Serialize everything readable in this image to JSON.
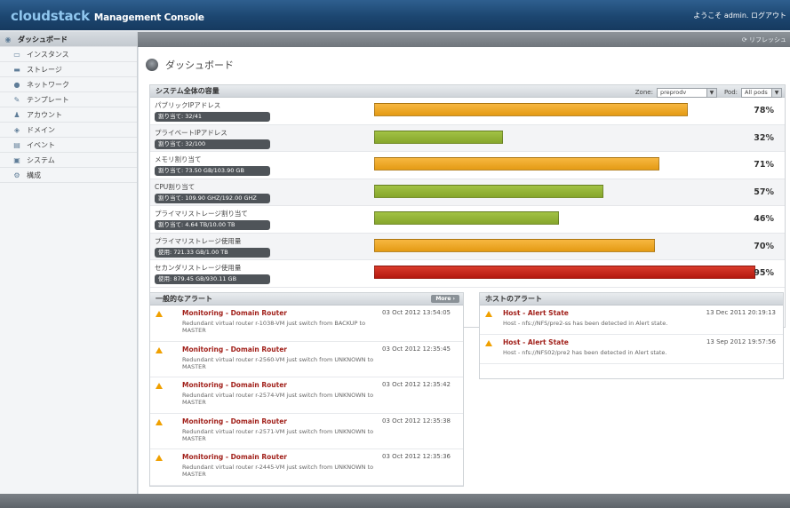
{
  "header": {
    "brand": "cloudstack",
    "console": "Management Console",
    "welcome": "ようこそ admin. ログアウト"
  },
  "subbar": {
    "refresh": "リフレッシュ"
  },
  "sidebar": {
    "items": [
      {
        "label": "ダッシュボード",
        "icon": "dashboard-icon",
        "active": true
      },
      {
        "label": "インスタンス",
        "icon": "instance-icon"
      },
      {
        "label": "ストレージ",
        "icon": "storage-icon"
      },
      {
        "label": "ネットワーク",
        "icon": "network-icon"
      },
      {
        "label": "テンプレート",
        "icon": "template-icon"
      },
      {
        "label": "アカウント",
        "icon": "account-icon"
      },
      {
        "label": "ドメイン",
        "icon": "domain-icon"
      },
      {
        "label": "イベント",
        "icon": "event-icon"
      },
      {
        "label": "システム",
        "icon": "system-icon"
      },
      {
        "label": "構成",
        "icon": "config-icon"
      }
    ]
  },
  "page_title": "ダッシュボード",
  "capacity": {
    "title": "システム全体の容量",
    "zone_label": "Zone:",
    "zone_value": "preprodv",
    "pod_label": "Pod:",
    "pod_value": "All pods",
    "rows": [
      {
        "label": "パブリックIPアドレス",
        "sub": "割り当て: 32/41",
        "percent": 78,
        "pct_text": "78%",
        "color": "orange"
      },
      {
        "label": "プライベートIPアドレス",
        "sub": "割り当て: 32/100",
        "percent": 32,
        "pct_text": "32%",
        "color": "green"
      },
      {
        "label": "メモリ割り当て",
        "sub": "割り当て: 73.50 GB/103.90 GB",
        "percent": 71,
        "pct_text": "71%",
        "color": "orange"
      },
      {
        "label": "CPU割り当て",
        "sub": "割り当て: 109.90 GHZ/192.00 GHZ",
        "percent": 57,
        "pct_text": "57%",
        "color": "green"
      },
      {
        "label": "プライマリストレージ割り当て",
        "sub": "割り当て: 4.64 TB/10.00 TB",
        "percent": 46,
        "pct_text": "46%",
        "color": "green"
      },
      {
        "label": "プライマリストレージ使用量",
        "sub": "使用: 721.33 GB/1.00 TB",
        "percent": 70,
        "pct_text": "70%",
        "color": "orange"
      },
      {
        "label": "セカンダリストレージ使用量",
        "sub": "使用: 879.45 GB/930.11 GB",
        "percent": 95,
        "pct_text": "95%",
        "color": "red"
      }
    ]
  },
  "recent_alerts": {
    "title": "一般的なアラート",
    "more": "More ›",
    "items": [
      {
        "title": "Monitoring - Domain Router",
        "time": "03 Oct 2012 13:54:05",
        "msg": "Redundant virtual router r-1038-VM just switch from BACKUP to MASTER"
      },
      {
        "title": "Monitoring - Domain Router",
        "time": "03 Oct 2012 12:35:45",
        "msg": "Redundant virtual router r-2560-VM just switch from UNKNOWN to MASTER"
      },
      {
        "title": "Monitoring - Domain Router",
        "time": "03 Oct 2012 12:35:42",
        "msg": "Redundant virtual router r-2574-VM just switch from UNKNOWN to MASTER"
      },
      {
        "title": "Monitoring - Domain Router",
        "time": "03 Oct 2012 12:35:38",
        "msg": "Redundant virtual router r-2571-VM just switch from UNKNOWN to MASTER"
      },
      {
        "title": "Monitoring - Domain Router",
        "time": "03 Oct 2012 12:35:36",
        "msg": "Redundant virtual router r-2445-VM just switch from UNKNOWN to MASTER"
      }
    ]
  },
  "host_alerts": {
    "title": "ホストのアラート",
    "items": [
      {
        "title": "Host - Alert State",
        "time": "13 Dec 2011 20:19:13",
        "msg": "Host - nfs://NFS/pre2-ss has been detected in Alert state."
      },
      {
        "title": "Host - Alert State",
        "time": "13 Sep 2012 19:57:56",
        "msg": "Host - nfs://NFS02/pre2 has been detected in Alert state."
      }
    ]
  }
}
